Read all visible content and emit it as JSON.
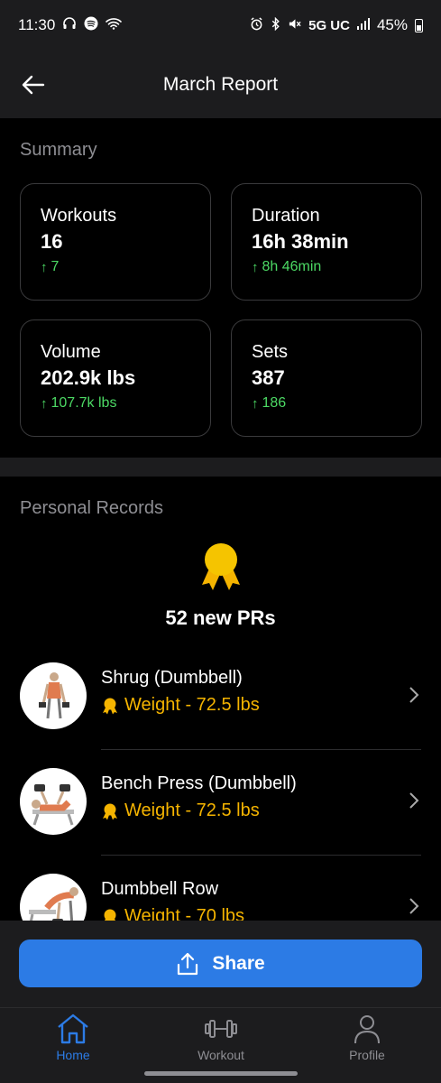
{
  "status_bar": {
    "time": "11:30",
    "network": "5G UC",
    "battery": "45%"
  },
  "header": {
    "title": "March Report"
  },
  "summary": {
    "label": "Summary",
    "cards": [
      {
        "label": "Workouts",
        "value": "16",
        "delta": "7"
      },
      {
        "label": "Duration",
        "value": "16h 38min",
        "delta": "8h 46min"
      },
      {
        "label": "Volume",
        "value": "202.9k lbs",
        "delta": "107.7k lbs"
      },
      {
        "label": "Sets",
        "value": "387",
        "delta": "186"
      }
    ]
  },
  "personal_records": {
    "label": "Personal Records",
    "count_text": "52 new PRs",
    "items": [
      {
        "name": "Shrug (Dumbbell)",
        "detail": "Weight - 72.5 lbs"
      },
      {
        "name": "Bench Press (Dumbbell)",
        "detail": "Weight - 72.5 lbs"
      },
      {
        "name": "Dumbbell Row",
        "detail": "Weight - 70 lbs"
      }
    ]
  },
  "share": {
    "label": "Share"
  },
  "nav": {
    "items": [
      {
        "label": "Home",
        "icon": "home-icon",
        "active": true
      },
      {
        "label": "Workout",
        "icon": "dumbbell-icon",
        "active": false
      },
      {
        "label": "Profile",
        "icon": "person-icon",
        "active": false
      }
    ]
  },
  "colors": {
    "accent": "#2c7be5",
    "positive": "#4cd964",
    "pr_gold": "#f5b400",
    "background": "#000000",
    "surface": "#1c1c1e"
  }
}
